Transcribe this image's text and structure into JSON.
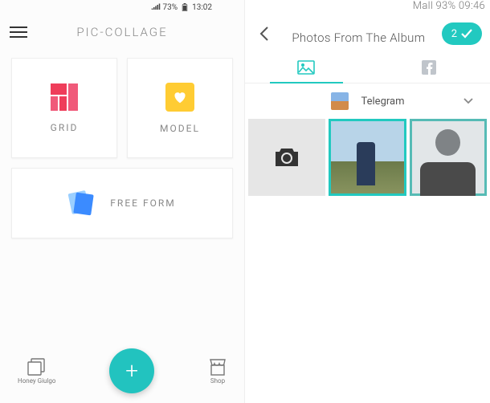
{
  "status_left": {
    "battery_pct": "73%",
    "time": "13:02"
  },
  "status_right": "Mall 93% 09:46",
  "app": {
    "title": "PIC-COLLAGE"
  },
  "cards": {
    "grid": "GRID",
    "model": "MODEL",
    "freeform": "FREE FORM"
  },
  "bottom": {
    "left": "Honey Giulgo",
    "right": "Shop"
  },
  "right": {
    "title": "Photos From The Album",
    "selected_count": "2",
    "album_name": "Telegram"
  },
  "colors": {
    "accent": "#22c9c0",
    "grid_icon": "#ef3d5a",
    "model_icon": "#ffcc33"
  }
}
